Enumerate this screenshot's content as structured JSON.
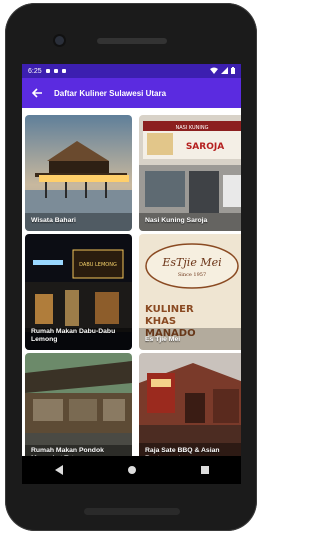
{
  "status": {
    "time": "6:25"
  },
  "appbar": {
    "title": "Daftar Kuliner Sulawesi Utara"
  },
  "items": [
    {
      "label": "Wisata Bahari"
    },
    {
      "label": "Nasi Kuning Saroja"
    },
    {
      "label": "Rumah Makan Dabu-Dabu Lemong"
    },
    {
      "label": "Es Tjie Mei"
    },
    {
      "label": "Rumah Makan Pondok Maengket Teterusan"
    },
    {
      "label": "Raja Sate BBQ & Asian Restaurant"
    }
  ],
  "images": {
    "sign_text": "SAROJA",
    "sign_subtext": "NASI KUNING",
    "logo_text": "EsTjie Mei",
    "logo_since": "Since 1957",
    "kuliner_text": "KULINER",
    "khas_text": "KHAS",
    "manado_text": "MANADO",
    "neon_text": "DABU LEMONG"
  },
  "colors": {
    "status_bar": "#3c1fb0",
    "app_bar": "#5b2be0"
  }
}
